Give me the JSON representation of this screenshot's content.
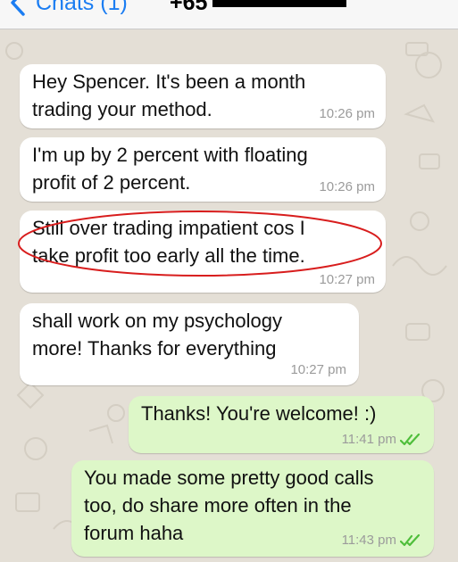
{
  "header": {
    "back_label": "Chats (1)",
    "contact_number": "+65"
  },
  "messages": [
    {
      "direction": "incoming",
      "text": "Hey Spencer. It's been a month\ntrading your method.",
      "time": "10:26 pm"
    },
    {
      "direction": "incoming",
      "text": "I'm up by 2 percent with floating\nprofit of 2 percent.",
      "time": "10:26 pm"
    },
    {
      "direction": "incoming",
      "text": "Still over trading impatient cos I\ntake profit too early all the time.",
      "time": "10:27 pm",
      "annotation": "circled in red"
    },
    {
      "direction": "incoming",
      "text": "shall work on my psychology\nmore! Thanks for everything",
      "time": "10:27 pm"
    },
    {
      "direction": "outgoing",
      "text": "Thanks! You're welcome! :)",
      "time": "11:41 pm",
      "status": "read"
    },
    {
      "direction": "outgoing",
      "text": "You made some pretty good calls\ntoo, do share more often in the\nforum haha",
      "time": "11:43 pm",
      "status": "read"
    }
  ],
  "icons": {
    "back": "chevron-left-icon",
    "read_receipt": "double-check-icon"
  },
  "colors": {
    "accent": "#1b7df2",
    "incoming_bubble": "#ffffff",
    "outgoing_bubble": "#ddf7c8",
    "read_ticks": "#4fbe3b",
    "annotation_red": "#d81d1d",
    "timestamp": "#9b9b9b"
  }
}
